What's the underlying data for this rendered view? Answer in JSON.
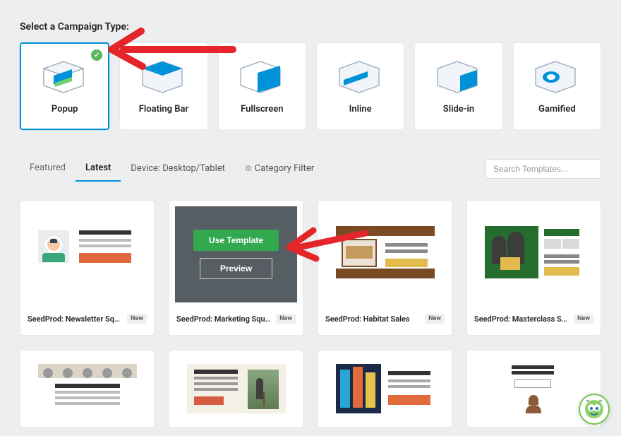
{
  "section_title": "Select a Campaign Type:",
  "campaign_types": [
    {
      "label": "Popup",
      "selected": true,
      "icon": "window-popup-icon"
    },
    {
      "label": "Floating Bar",
      "selected": false,
      "icon": "floating-bar-icon"
    },
    {
      "label": "Fullscreen",
      "selected": false,
      "icon": "fullscreen-icon"
    },
    {
      "label": "Inline",
      "selected": false,
      "icon": "inline-icon"
    },
    {
      "label": "Slide-in",
      "selected": false,
      "icon": "slidein-icon"
    },
    {
      "label": "Gamified",
      "selected": false,
      "icon": "gamified-icon"
    }
  ],
  "tabs": {
    "featured": "Featured",
    "latest": "Latest",
    "device": "Device: Desktop/Tablet",
    "category": "Category Filter"
  },
  "search_placeholder": "Search Templates...",
  "templates": [
    {
      "title": "SeedProd: Newsletter Squeeze",
      "new": true,
      "name": "newsletter-squeeze"
    },
    {
      "title": "SeedProd: Marketing Squeeze",
      "new": true,
      "name": "marketing-squeeze",
      "hovered": true
    },
    {
      "title": "SeedProd: Habitat Sales",
      "new": true,
      "name": "habitat-sales"
    },
    {
      "title": "SeedProd: Masterclass Sales",
      "new": true,
      "name": "masterclass-sales"
    }
  ],
  "overlay": {
    "use_template": "Use Template",
    "preview": "Preview"
  },
  "badge_new_label": "New"
}
